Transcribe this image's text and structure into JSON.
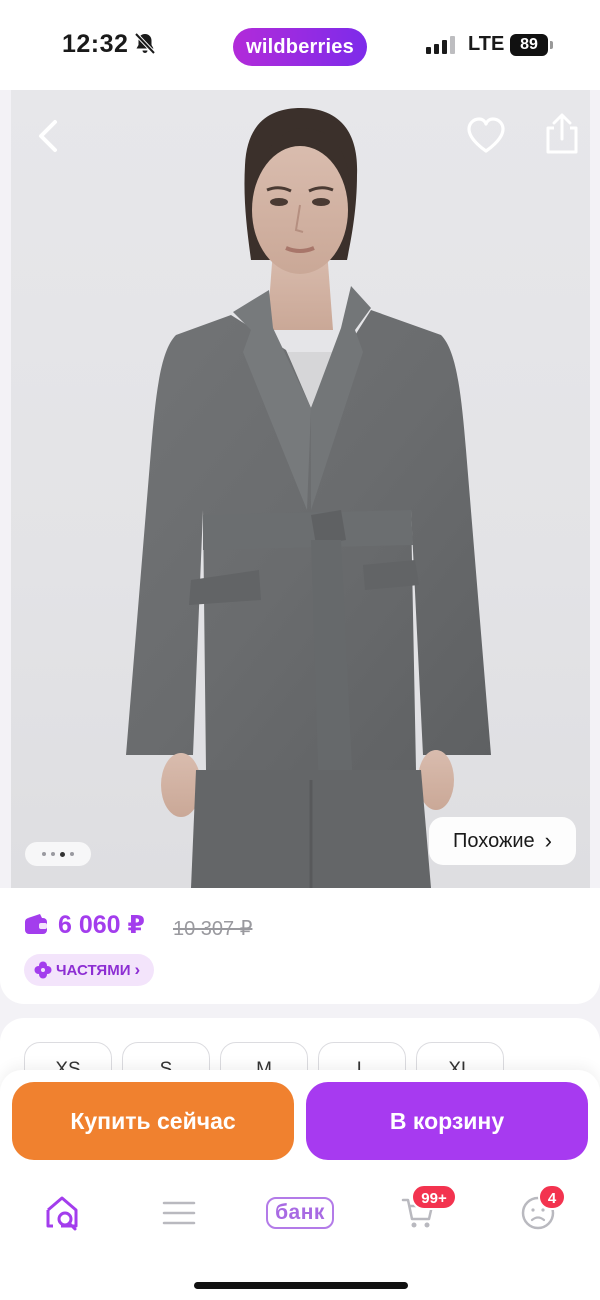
{
  "status_bar": {
    "time": "12:32",
    "brand": "wildberries",
    "network": "LTE",
    "battery": "89"
  },
  "gallery": {
    "similar_label": "Похожие",
    "similar_chevron": "›",
    "page_count": 4,
    "active_page": 3,
    "icons": [
      "chevron-left-icon",
      "heart-icon",
      "share-icon"
    ]
  },
  "price": {
    "current": "6 060 ₽",
    "old": "10 307 ₽",
    "installments_label": "ЧАСТЯМИ",
    "installments_chevron": "›",
    "accent_color": "#a33ded"
  },
  "sizes": [
    "XS",
    "S",
    "M",
    "L",
    "XL"
  ],
  "actions": {
    "buy_now": "Купить сейчас",
    "add_to_cart": "В корзину",
    "buy_color": "#f0812f",
    "cart_color": "#a73af0"
  },
  "tab_bar": {
    "bank_label": "банк",
    "cart_badge": "99+",
    "profile_badge": "4",
    "icons": [
      "home-search-icon",
      "menu-icon",
      "bank-icon",
      "cart-icon",
      "profile-icon"
    ]
  }
}
